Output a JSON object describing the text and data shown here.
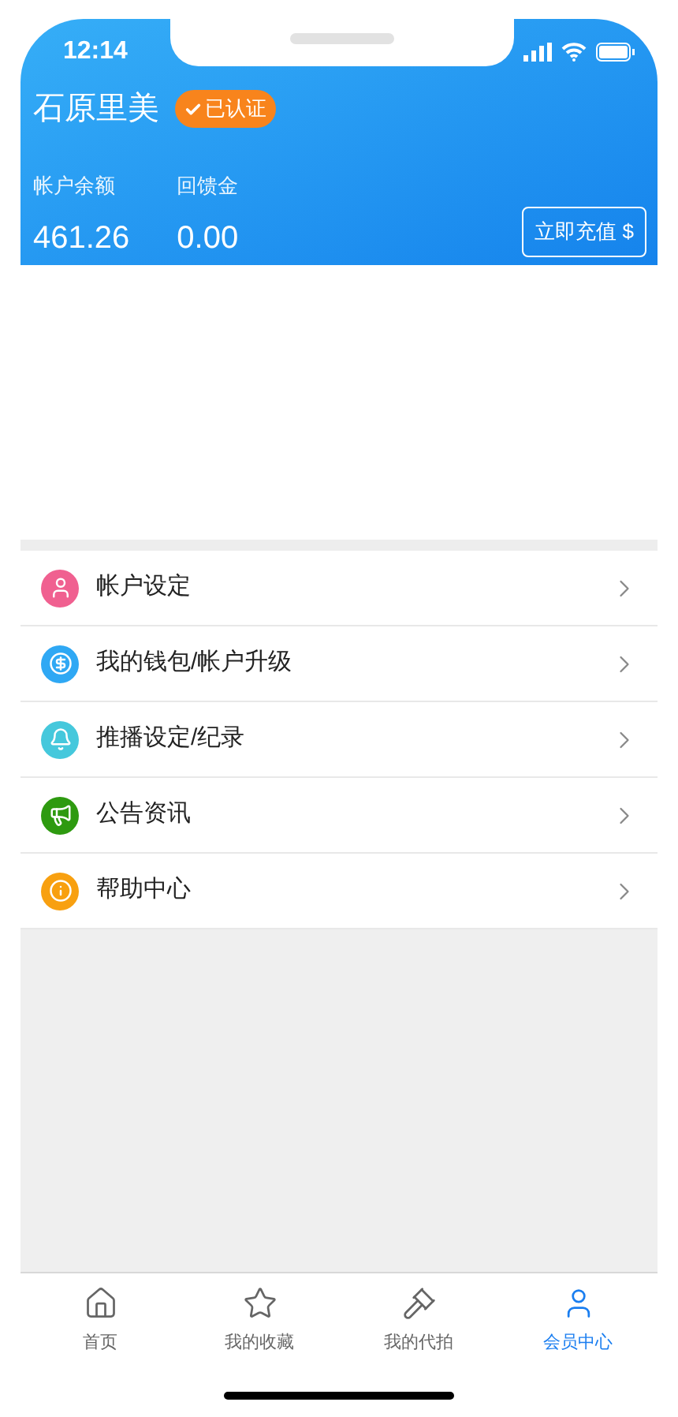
{
  "status_bar": {
    "time": "12:14"
  },
  "profile": {
    "name": "石原里美",
    "badge": {
      "label": "已认证",
      "verified": true
    }
  },
  "balances": [
    {
      "label": "帐户余额",
      "value": "461.26"
    },
    {
      "label": "回馈金",
      "value": "0.00"
    }
  ],
  "recharge_button": {
    "label": "立即充值",
    "symbol": "$"
  },
  "menu": [
    {
      "kind": "user",
      "label": "帐户设定",
      "color": "#f06090"
    },
    {
      "kind": "wallet",
      "label": "我的钱包/帐户升级",
      "color": "#2fa8f4"
    },
    {
      "kind": "bell",
      "label": "推播设定/纪录",
      "color": "#45c8dc"
    },
    {
      "kind": "megaphone",
      "label": "公告资讯",
      "color": "#2e9a10"
    },
    {
      "kind": "info",
      "label": "帮助中心",
      "color": "#f8a010"
    }
  ],
  "tab_bar": [
    {
      "kind": "home",
      "label": "首页",
      "selected": false
    },
    {
      "kind": "star",
      "label": "我的收藏",
      "selected": false
    },
    {
      "kind": "gavel",
      "label": "我的代拍",
      "selected": false
    },
    {
      "kind": "user",
      "label": "会员中心",
      "selected": true
    }
  ]
}
